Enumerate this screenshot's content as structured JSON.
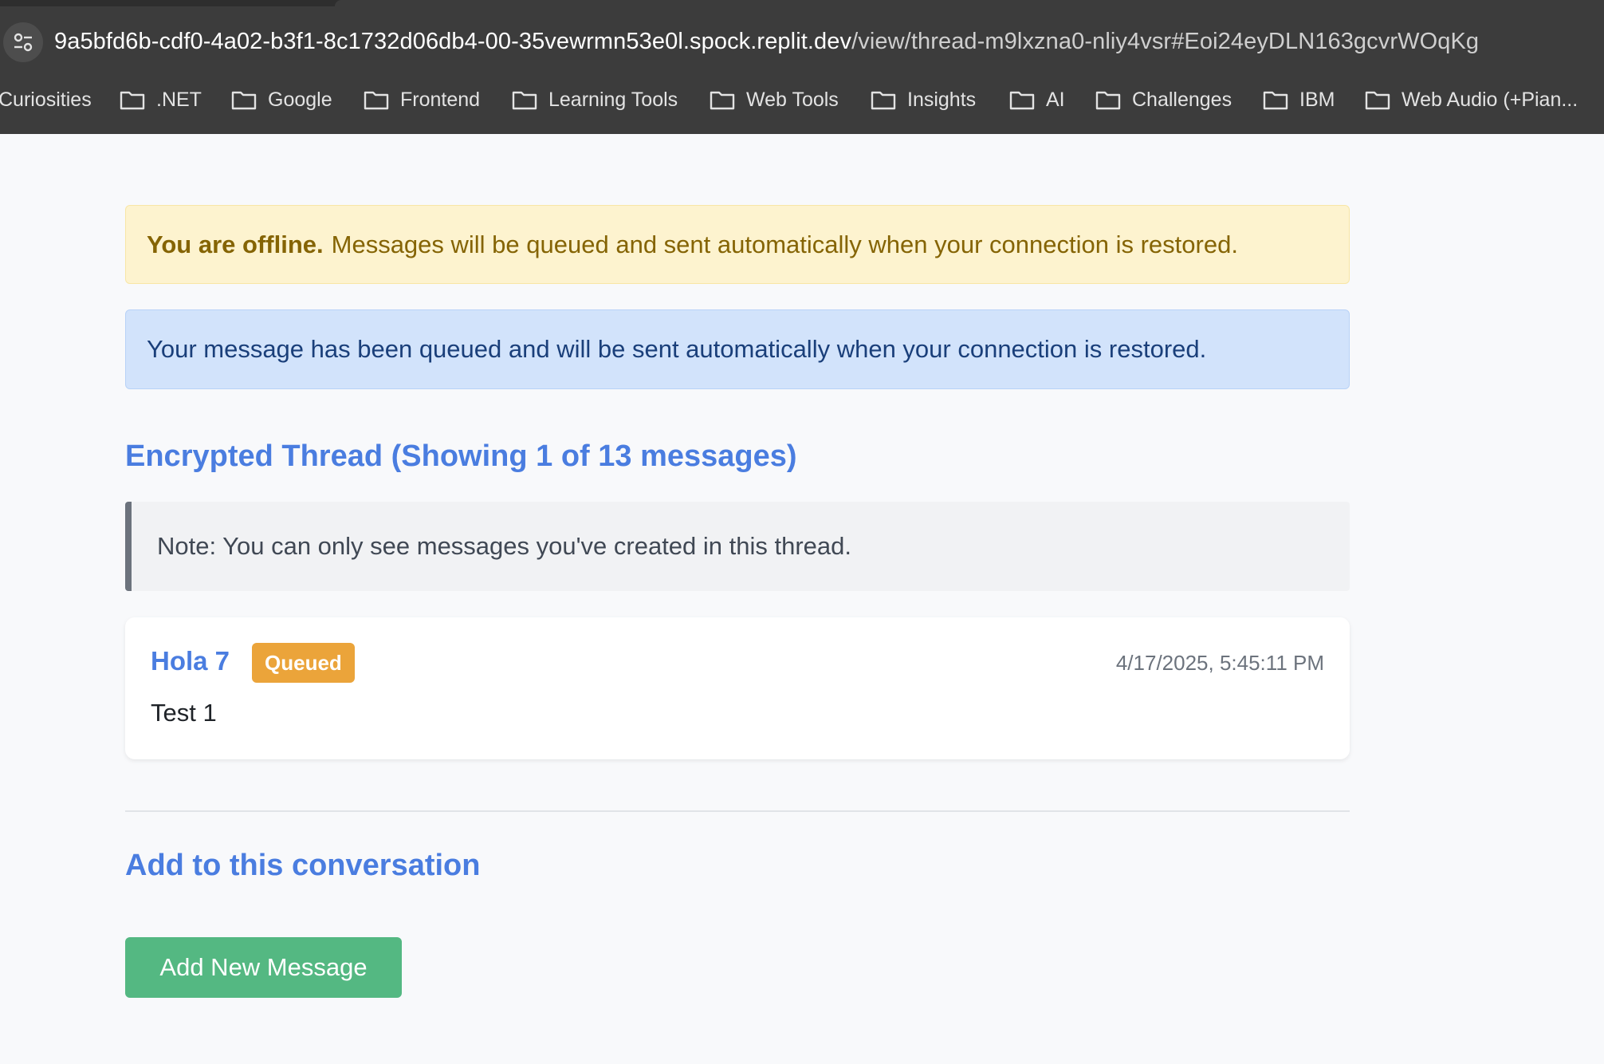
{
  "browser": {
    "url_host": "9a5bfd6b-cdf0-4a02-b3f1-8c1732d06db4-00-35vewrmn53e0l.spock.replit.dev",
    "url_path": "/view/thread-m9lxzna0-nliy4vsr#Eoi24eyDLN163gcvrWOqKg",
    "bookmarks": [
      "Curiosities",
      ".NET",
      "Google",
      "Frontend",
      "Learning Tools",
      "Web Tools",
      "Insights",
      "AI",
      "Challenges",
      "IBM",
      "Web Audio (+Pian..."
    ]
  },
  "alerts": {
    "offline_strong": "You are offline.",
    "offline_text": "Messages will be queued and sent automatically when your connection is restored.",
    "queued_text": "Your message has been queued and will be sent automatically when your connection is restored."
  },
  "thread": {
    "title": "Encrypted Thread (Showing 1 of 13 messages)",
    "note": "Note: You can only see messages you've created in this thread."
  },
  "messages": [
    {
      "author": "Hola 7",
      "status": "Queued",
      "timestamp": "4/17/2025, 5:45:11 PM",
      "body": "Test 1"
    }
  ],
  "compose": {
    "title": "Add to this conversation",
    "button_label": "Add New Message"
  },
  "colors": {
    "accent": "#4a7de0",
    "warning_bg": "#fdf3cf",
    "info_bg": "#d2e3fb",
    "queued_badge": "#eba43a",
    "button_green": "#54b882"
  },
  "icons": {
    "site_info": "tune-icon",
    "bookmark": "folder-icon"
  }
}
